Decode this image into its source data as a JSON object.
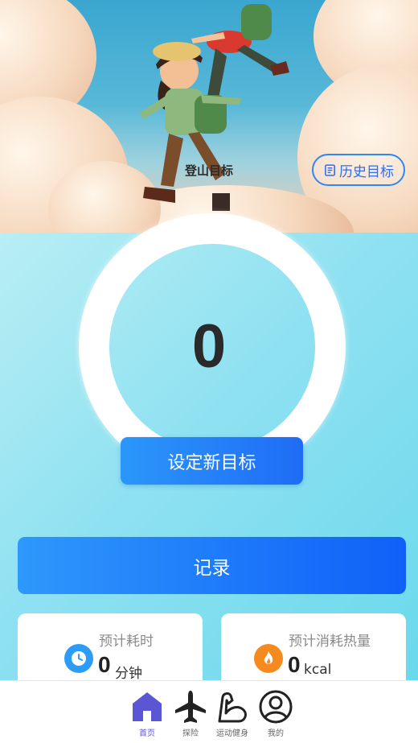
{
  "hero": {
    "title": "登山目标",
    "history_button": "历史目标"
  },
  "goal": {
    "value": "0",
    "set_button": "设定新目标"
  },
  "record_button": "记录",
  "stats": {
    "time": {
      "label": "预计耗时",
      "value": "0",
      "unit": "分钟",
      "icon": "clock-icon"
    },
    "calories": {
      "label": "预计消耗热量",
      "value": "0",
      "unit": "kcal",
      "icon": "fire-icon"
    }
  },
  "tabbar": {
    "items": [
      {
        "label": "首页",
        "icon": "home-icon",
        "active": true
      },
      {
        "label": "探险",
        "icon": "airplane-icon",
        "active": false
      },
      {
        "label": "运动健身",
        "icon": "muscle-icon",
        "active": false
      },
      {
        "label": "我的",
        "icon": "user-icon",
        "active": false
      }
    ]
  },
  "colors": {
    "accent": "#1f6cf6",
    "active_tab": "#5b57d4",
    "clock_icon": "#2d9cf6",
    "fire_icon": "#f58a1f"
  }
}
